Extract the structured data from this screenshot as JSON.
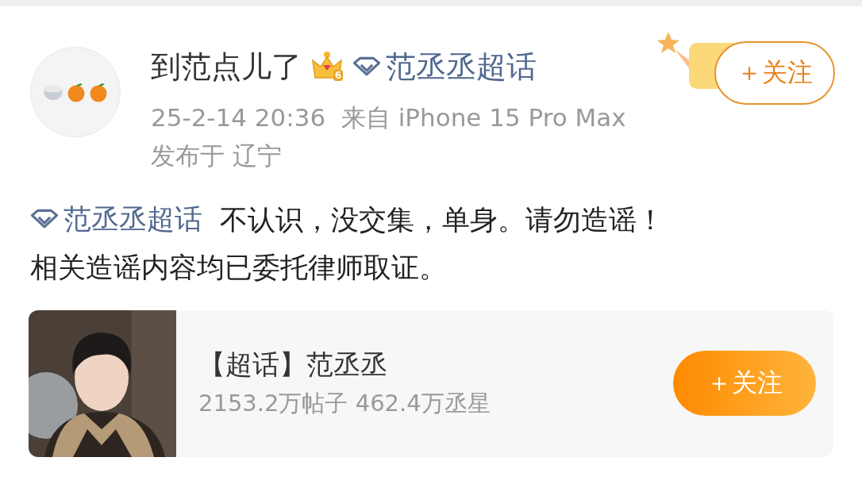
{
  "post": {
    "author": {
      "name": "到范点儿了",
      "level_badge": "6",
      "topic_link": "范丞丞超话"
    },
    "follow_button": {
      "label": "＋关注",
      "followed": false
    },
    "time": "25-2-14 20:36",
    "source": "来自 iPhone 15 Pro Max",
    "location": "发布于 辽宁",
    "topic_link": "范丞丞超话",
    "text_lines": [
      "不认识，没交集，单身。请勿造谣！",
      "相关造谣内容均已委托律师取证。"
    ]
  },
  "topic_card": {
    "title": "【超话】范丞丞",
    "stats": "2153.2万帖子 462.4万丞星",
    "follow_button": {
      "label": "＋关注",
      "followed": false
    }
  }
}
